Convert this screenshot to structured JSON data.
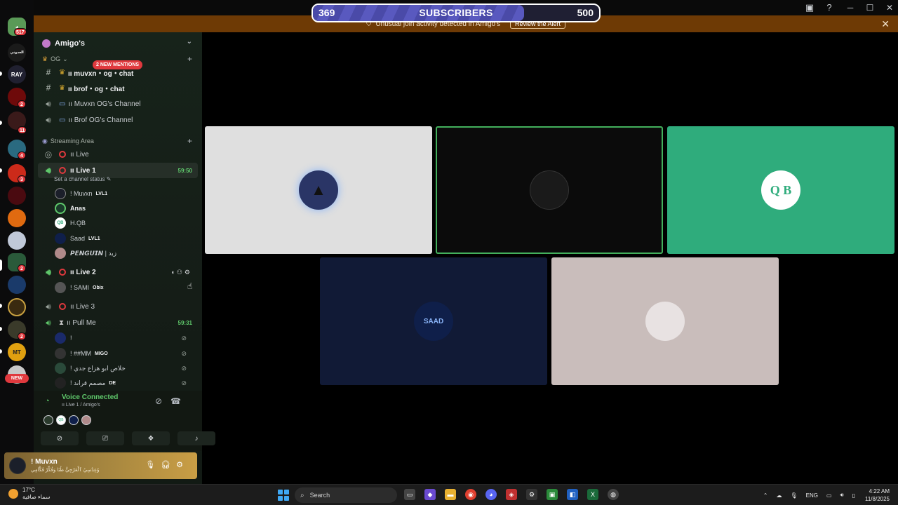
{
  "subscribers": {
    "current": "369",
    "label": "SUBSCRIBERS",
    "goal": "500",
    "progress": 0.738
  },
  "alert": {
    "text": "Unusual join activity detected in Amigo's",
    "button": "Review the Alert"
  },
  "window": {
    "minimize": "─",
    "maximize": "☐",
    "close": "✕"
  },
  "rail": {
    "home_badge": "517",
    "labels": {
      "s2": "العدوني",
      "s3": "RAY",
      "s10": "MT",
      "s11": "MT"
    },
    "badges": {
      "b1": "2",
      "b2": "11",
      "b3": "4",
      "b4": "3",
      "b5": "2",
      "b6": "2",
      "b7": "2"
    },
    "new_label": "NEW"
  },
  "guild": {
    "name": "Amigo's"
  },
  "mentions_chip": "2 NEW MENTIONS",
  "categories": {
    "og": "OG",
    "streaming": "Streaming Area"
  },
  "channels": {
    "muvxn_chat": "ıı muvxn・og・chat",
    "brof_chat": "ıı brof・og・chat",
    "muvxn_voice": "ıı Muvxn OG's Channel",
    "brof_voice": "ıı Brof OG's Channel",
    "live": "ıı Live",
    "live1": "ıı Live 1",
    "live1_time": "59:50",
    "live1_status": "Set a channel status",
    "live2": "ıı Live 2",
    "live3": "ıı Live 3",
    "pullme": "ıı Pull Me",
    "pullme_time": "59:31"
  },
  "live1_members": [
    {
      "name": "! Muvxn",
      "tag": "LVL1"
    },
    {
      "name": "Anas",
      "tag": ""
    },
    {
      "name": "H.QB",
      "tag": ""
    },
    {
      "name": "Saad",
      "tag": "LVL1"
    },
    {
      "name": "𝙋𝙀𝙉𝙂𝙐𝙄𝙉 | زيد",
      "tag": ""
    }
  ],
  "live2_members": [
    {
      "name": "! SAMI",
      "tag": "Obix"
    }
  ],
  "pullme_members": [
    {
      "name": "!",
      "tag": ""
    },
    {
      "name": "! ##MM",
      "tag": "MIGO"
    },
    {
      "name": "! خلاص ابو هزاع جدي",
      "tag": ""
    },
    {
      "name": "! مصمم قراند",
      "tag": "DE"
    }
  ],
  "voice": {
    "title": "Voice Connected",
    "sub": "ıı Live 1 / Amigo's"
  },
  "user": {
    "name": "! Muvxn",
    "status": "ۇعِدْسِيُ ٱلْعَرْجِيُّ ظُنَا وَفُكِّرْ فَكَّامِي"
  },
  "tiles": [
    {
      "bg": "#dfdfdf",
      "border": "#dfdfdf",
      "avatar_bg": "#2a3566",
      "avatar_text": ""
    },
    {
      "bg": "#0b0b0b",
      "border": "#43b05c",
      "avatar_bg": "#1a1a1a",
      "avatar_text": ""
    },
    {
      "bg": "#2fac7c",
      "border": "#2fac7c",
      "avatar_bg": "#ffffff",
      "avatar_text": "Q B"
    },
    {
      "bg": "#111a36",
      "border": "#111a36",
      "avatar_bg": "#0f1f4a",
      "avatar_text": "SAAD"
    },
    {
      "bg": "#c9bdbb",
      "border": "#c9bdbb",
      "avatar_bg": "#e8e2e2",
      "avatar_text": ""
    }
  ],
  "taskbar": {
    "temp": "17°C",
    "weather": "سماء صافية",
    "search": "Search",
    "lang": "ENG",
    "time": "4:22 AM",
    "date": "11/8/2025"
  }
}
